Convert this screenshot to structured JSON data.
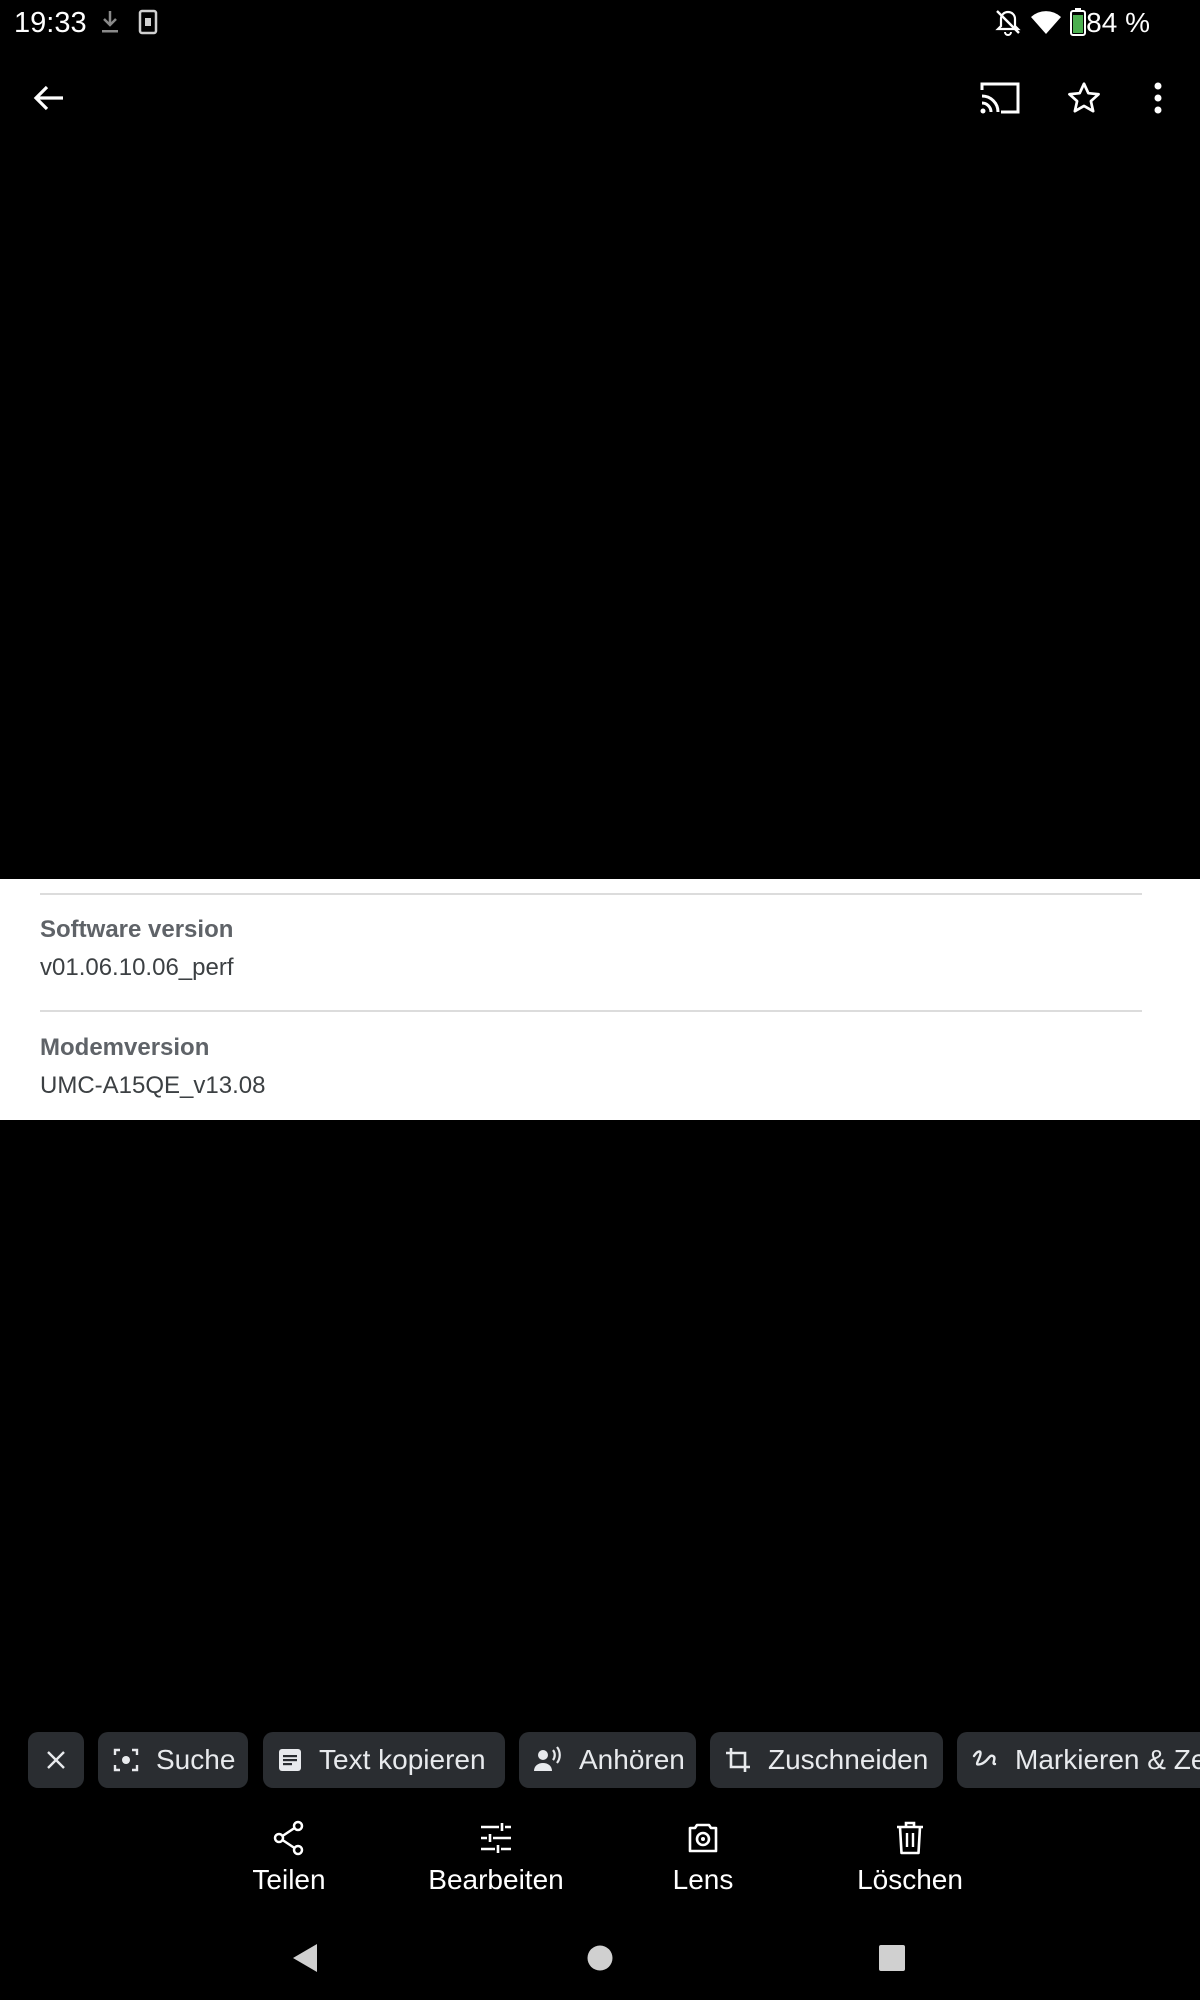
{
  "status_bar": {
    "time": "19:33",
    "battery": "84 %",
    "icons": [
      "download-icon",
      "screenshot-icon",
      "bell-off-icon",
      "wifi-icon",
      "battery-icon"
    ]
  },
  "top_bar": {
    "icons": [
      "back-arrow-icon",
      "cast-icon",
      "star-outline-icon",
      "more-vert-icon"
    ]
  },
  "details": [
    {
      "label": "Software version",
      "value": "v01.06.10.06_perf"
    },
    {
      "label": "Modemversion",
      "value": "UMC-A15QE_v13.08"
    }
  ],
  "chips": [
    {
      "label": "Suche",
      "icon": "lens-search-icon"
    },
    {
      "label": "Text kopieren",
      "icon": "text-copy-icon"
    },
    {
      "label": "Anhören",
      "icon": "listen-icon"
    },
    {
      "label": "Zuschneiden",
      "icon": "crop-icon"
    },
    {
      "label": "Markieren & Ze",
      "icon": "markup-icon"
    }
  ],
  "actions": [
    {
      "label": "Teilen",
      "icon": "share-icon"
    },
    {
      "label": "Bearbeiten",
      "icon": "tune-icon"
    },
    {
      "label": "Lens",
      "icon": "lens-icon"
    },
    {
      "label": "Löschen",
      "icon": "trash-icon"
    }
  ],
  "nav": {
    "icons": [
      "nav-back-icon",
      "nav-home-icon",
      "nav-recents-icon"
    ]
  },
  "colors": {
    "background": "#000000",
    "card": "#ffffff",
    "chip": "#2a2d31",
    "label": "#5f6368"
  }
}
